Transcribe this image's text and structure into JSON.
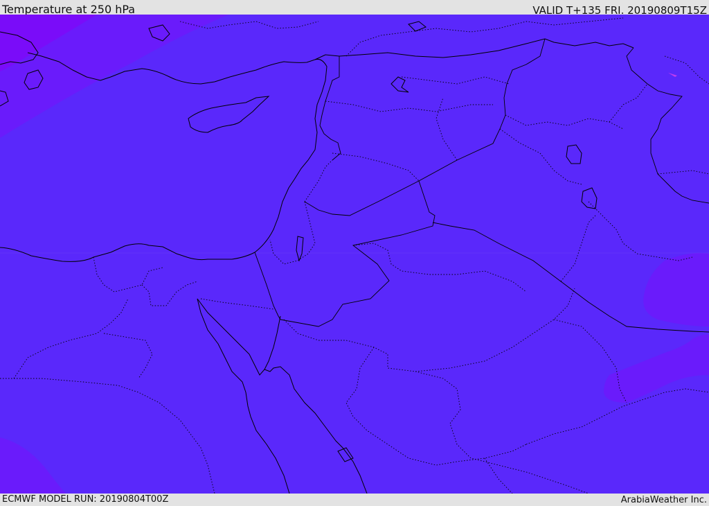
{
  "header": {
    "title": "Temperature at 250 hPa",
    "valid": "VALID T+135 FRI. 20190809T15Z"
  },
  "footer": {
    "model_run": "ECMWF MODEL RUN: 20190804T00Z",
    "credit": "ArabiaWeather Inc."
  },
  "map": {
    "colors": {
      "base_field": "#5a28fb",
      "cooler_band": "#6a1bfb",
      "coldest_corner": "#7f07f8",
      "coastline": "#000000",
      "border": "#000000"
    }
  }
}
